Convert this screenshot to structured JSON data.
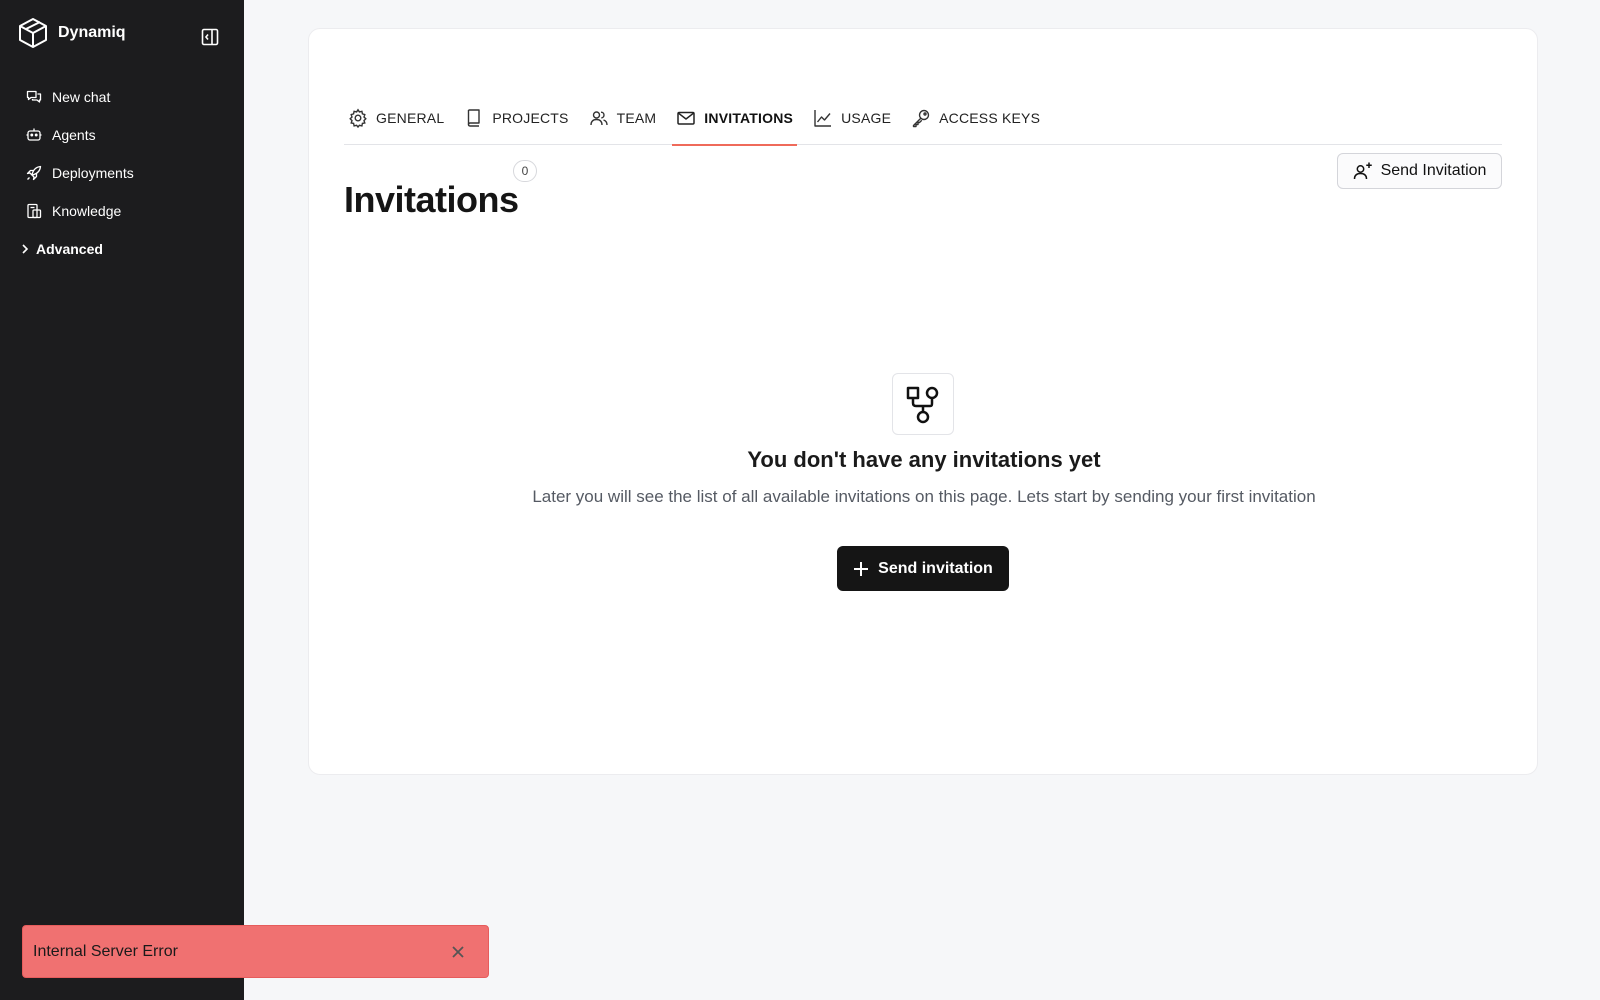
{
  "app": {
    "name": "Dynamiq"
  },
  "sidebar": {
    "items": [
      {
        "label": "New chat",
        "icon": "chat-icon"
      },
      {
        "label": "Agents",
        "icon": "robot-icon"
      },
      {
        "label": "Deployments",
        "icon": "rocket-icon"
      },
      {
        "label": "Knowledge",
        "icon": "book-icon"
      }
    ],
    "advanced_label": "Advanced"
  },
  "tabs": [
    {
      "label": "GENERAL",
      "icon": "gear-icon",
      "active": false
    },
    {
      "label": "PROJECTS",
      "icon": "book-icon",
      "active": false
    },
    {
      "label": "TEAM",
      "icon": "users-icon",
      "active": false
    },
    {
      "label": "INVITATIONS",
      "icon": "envelope-icon",
      "active": true
    },
    {
      "label": "USAGE",
      "icon": "chart-line-icon",
      "active": false
    },
    {
      "label": "ACCESS KEYS",
      "icon": "key-icon",
      "active": false
    }
  ],
  "page": {
    "title": "Invitations",
    "count": "0",
    "send_button_top": "Send Invitation"
  },
  "empty_state": {
    "icon": "git-fork-icon",
    "title": "You don't have any invitations yet",
    "subtitle": "Later you will see the list of all available invitations on this page. Lets start by sending your first invitation",
    "button": "Send invitation"
  },
  "toast": {
    "message": "Internal Server Error"
  },
  "colors": {
    "sidebar_bg": "#1c1c1e",
    "accent": "#ef6a5a",
    "toast_bg": "#f07171",
    "primary_button": "#151515"
  }
}
